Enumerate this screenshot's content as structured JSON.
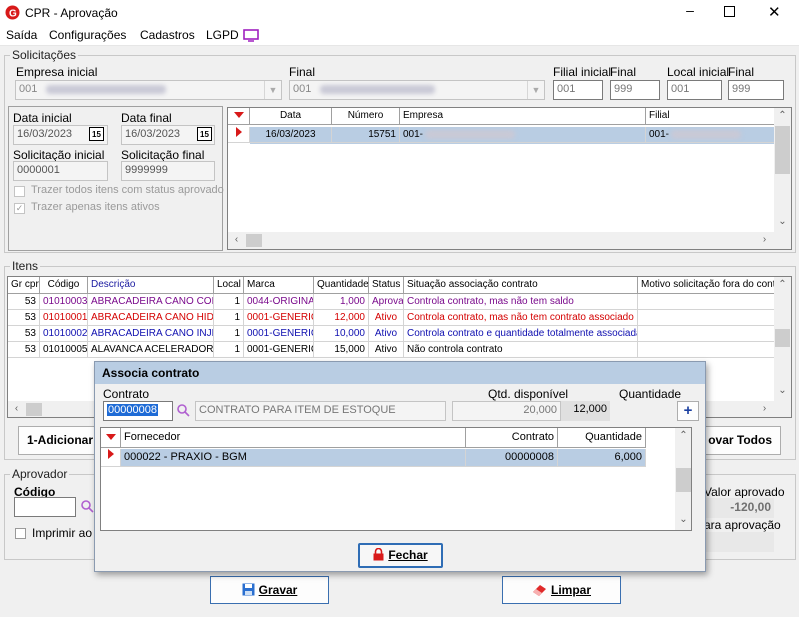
{
  "window": {
    "title": "CPR - Aprovação"
  },
  "menu": [
    "Saída",
    "Configurações",
    "Cadastros",
    "LGPD"
  ],
  "solicitacoes": {
    "legend": "Solicitações",
    "empresa_inicial_label": "Empresa inicial",
    "empresa_inicial_value": "001",
    "final_label": "Final",
    "final_value": "001",
    "filial_inicial_label": "Filial inicial",
    "filial_inicial_value": "001",
    "filial_final_label": "Final",
    "filial_final_value": "999",
    "local_inicial_label": "Local inicial",
    "local_inicial_value": "001",
    "local_final_label": "Final",
    "local_final_value": "999",
    "data_inicial_label": "Data inicial",
    "data_inicial_value": "16/03/2023",
    "data_final_label": "Data final",
    "data_final_value": "16/03/2023",
    "cal_label": "15",
    "solic_inicial_label": "Solicitação inicial",
    "solic_inicial_value": "0000001",
    "solic_final_label": "Solicitação final",
    "solic_final_value": "9999999",
    "chk_todos_label": "Trazer todos itens com status aprovado",
    "chk_ativos_label": "Trazer apenas itens ativos",
    "grid": {
      "headers": [
        "Data",
        "Número",
        "Empresa",
        "Filial"
      ],
      "row": {
        "data": "16/03/2023",
        "numero": "15751",
        "empresa": "001-",
        "filial": "001-"
      }
    }
  },
  "itens": {
    "legend": "Itens",
    "headers": [
      "Gr cpr",
      "Código",
      "Descrição",
      "Local",
      "Marca",
      "Quantidade",
      "Status",
      "Situação associação contrato",
      "Motivo solicitação fora do cont"
    ],
    "rows": [
      {
        "gr": "53",
        "codigo": "01010003",
        "descricao": "ABRACADEIRA CANO CON",
        "local": "1",
        "marca": "0044-ORIGINAL",
        "quantidade": "1,000",
        "status": "Aprovado",
        "situacao": "Controla contrato, mas não tem saldo",
        "motivo": "",
        "color": "#7a0a8c"
      },
      {
        "gr": "53",
        "codigo": "01010001",
        "descricao": "ABRACADEIRA CANO HIDR",
        "local": "1",
        "marca": "0001-GENERICO",
        "quantidade": "12,000",
        "status": "Ativo",
        "situacao": "Controla contrato, mas não tem contrato associado",
        "motivo": "",
        "color": "#d40000"
      },
      {
        "gr": "53",
        "codigo": "01010002",
        "descricao": "ABRACADEIRA CANO INJE",
        "local": "1",
        "marca": "0001-GENERICO",
        "quantidade": "10,000",
        "status": "Ativo",
        "situacao": "Controla contrato e quantidade totalmente associada",
        "motivo": "",
        "color": "#1010b0"
      },
      {
        "gr": "53",
        "codigo": "01010005",
        "descricao": "ALAVANCA ACELERADOR",
        "local": "1",
        "marca": "0001-GENERICO",
        "quantidade": "15,000",
        "status": "Ativo",
        "situacao": "Não controla contrato",
        "motivo": "",
        "color": "#000000"
      }
    ],
    "btn_adicionar": "1-Adicionar",
    "btn_aprovar_todos": "ovar Todos"
  },
  "aprovador": {
    "legend": "Aprovador",
    "codigo_label": "Código",
    "imprimir_label": "Imprimir ao fin",
    "valor_aprovado_label": "Valor aprovado",
    "valor_aprovado": "-120,00",
    "para_aprovacao_label": "ara aprovação"
  },
  "dialog": {
    "title": "Associa contrato",
    "contrato_label": "Contrato",
    "contrato_value": "00000008",
    "contrato_desc": "CONTRATO PARA ITEM DE ESTOQUE",
    "qtd_disp_label": "Qtd. disponível",
    "qtd_disp_value": "20,000",
    "quantidade_label": "Quantidade",
    "quantidade_value": "12,000",
    "plus": "+",
    "headers": [
      "Fornecedor",
      "Contrato",
      "Quantidade"
    ],
    "row": {
      "fornecedor": "000022 - PRAXIO - BGM",
      "contrato": "00000008",
      "quantidade": "6,000"
    },
    "btn_fechar": "Fechar"
  },
  "bottom": {
    "btn_gravar": "Gravar",
    "btn_limpar": "Limpar"
  },
  "colors": {
    "accent": "#d81919",
    "selection": "#b9cde3",
    "focus": "#2f6db5"
  }
}
